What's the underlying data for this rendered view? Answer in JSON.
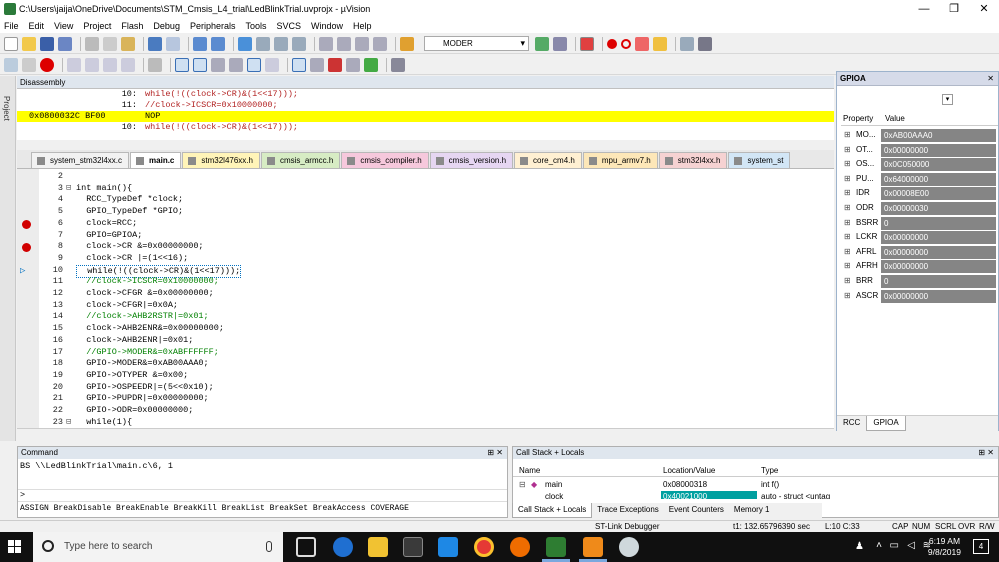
{
  "window": {
    "title": "C:\\Users\\jaija\\OneDrive\\Documents\\STM_Cmsis_L4_trial\\LedBlinkTrial.uvprojx - µVision",
    "min": "—",
    "max": "❐",
    "close": "✕"
  },
  "menu": [
    "File",
    "Edit",
    "View",
    "Project",
    "Flash",
    "Debug",
    "Peripherals",
    "Tools",
    "SVCS",
    "Window",
    "Help"
  ],
  "toolbar": {
    "target": "MODER"
  },
  "left_panel": {
    "label": "Project"
  },
  "disassembly": {
    "title": "Disassembly",
    "lines": [
      {
        "addr": "",
        "num": "10:",
        "code": "while(!((clock->CR)&(1<<17)));",
        "hl": false
      },
      {
        "addr": "",
        "num": "11:",
        "code": "//clock->ICSCR=0x10000000;",
        "hl": false
      },
      {
        "addr": "0x0800032C BF00",
        "num": "",
        "code": "NOP",
        "hl": true
      },
      {
        "addr": "",
        "num": "10:",
        "code": "while(!((clock->CR)&(1<<17)));",
        "hl": false
      }
    ]
  },
  "tabs": [
    {
      "label": "system_stm32l4xx.c",
      "color": "#f2f2f2",
      "active": false
    },
    {
      "label": "main.c",
      "color": "#ffffff",
      "active": true
    },
    {
      "label": "stm32l476xx.h",
      "color": "#fff4b8",
      "active": false
    },
    {
      "label": "cmsis_armcc.h",
      "color": "#d7ecc4",
      "active": false
    },
    {
      "label": "cmsis_compiler.h",
      "color": "#f6c8dc",
      "active": false
    },
    {
      "label": "cmsis_version.h",
      "color": "#e6d6f2",
      "active": false
    },
    {
      "label": "core_cm4.h",
      "color": "#fff0d2",
      "active": false
    },
    {
      "label": "mpu_armv7.h",
      "color": "#fde7b8",
      "active": false
    },
    {
      "label": "stm32l4xx.h",
      "color": "#f6d2d2",
      "active": false
    },
    {
      "label": "system_st",
      "color": "#d2e6f6",
      "active": false
    }
  ],
  "code": [
    {
      "n": "2",
      "t": "",
      "bp": false,
      "cur": false,
      "fold": ""
    },
    {
      "n": "3",
      "t": "int main(){",
      "bp": false,
      "cur": false,
      "fold": "⊟"
    },
    {
      "n": "4",
      "t": "  RCC_TypeDef *clock;",
      "bp": false,
      "cur": false,
      "fold": ""
    },
    {
      "n": "5",
      "t": "  GPIO_TypeDef *GPIO;",
      "bp": false,
      "cur": false,
      "fold": ""
    },
    {
      "n": "6",
      "t": "  clock=RCC;",
      "bp": true,
      "cur": false,
      "fold": ""
    },
    {
      "n": "7",
      "t": "  GPIO=GPIOA;",
      "bp": false,
      "cur": false,
      "fold": ""
    },
    {
      "n": "8",
      "t": "  clock->CR &=0x00000000;",
      "bp": true,
      "cur": false,
      "fold": ""
    },
    {
      "n": "9",
      "t": "  clock->CR |=(1<<16);",
      "bp": false,
      "cur": false,
      "fold": ""
    },
    {
      "n": "10",
      "t": "  while(!((clock->CR)&(1<<17)));",
      "bp": false,
      "cur": true,
      "fold": ""
    },
    {
      "n": "11",
      "t": "  //clock->ICSCR=0x10000000;",
      "bp": false,
      "cur": false,
      "fold": ""
    },
    {
      "n": "12",
      "t": "  clock->CFGR &=0x00000000;",
      "bp": false,
      "cur": false,
      "fold": ""
    },
    {
      "n": "13",
      "t": "  clock->CFGR|=0x0A;",
      "bp": false,
      "cur": false,
      "fold": ""
    },
    {
      "n": "14",
      "t": "  //clock->AHB2RSTR|=0x01;",
      "bp": false,
      "cur": false,
      "fold": ""
    },
    {
      "n": "15",
      "t": "  clock->AHB2ENR&=0x00000000;",
      "bp": false,
      "cur": false,
      "fold": ""
    },
    {
      "n": "16",
      "t": "  clock->AHB2ENR|=0x01;",
      "bp": false,
      "cur": false,
      "fold": ""
    },
    {
      "n": "17",
      "t": "  //GPIO->MODER&=0xABFFFFFF;",
      "bp": false,
      "cur": false,
      "fold": ""
    },
    {
      "n": "18",
      "t": "  GPIO->MODER&=0xAB00AAA0;",
      "bp": false,
      "cur": false,
      "fold": ""
    },
    {
      "n": "19",
      "t": "  GPIO->OTYPER &=0x00;",
      "bp": false,
      "cur": false,
      "fold": ""
    },
    {
      "n": "20",
      "t": "  GPIO->OSPEEDR|=(5<<0x10);",
      "bp": false,
      "cur": false,
      "fold": ""
    },
    {
      "n": "21",
      "t": "  GPIO->PUPDR|=0x00000000;",
      "bp": false,
      "cur": false,
      "fold": ""
    },
    {
      "n": "22",
      "t": "  GPIO->ODR=0x00000000;",
      "bp": false,
      "cur": false,
      "fold": ""
    },
    {
      "n": "23",
      "t": "  while(1){",
      "bp": false,
      "cur": false,
      "fold": "⊟"
    }
  ],
  "gpio": {
    "title": "GPIOA",
    "col_property": "Property",
    "col_value": "Value",
    "rows": [
      {
        "name": "MO...",
        "value": "0xAB00AAA0"
      },
      {
        "name": "OT...",
        "value": "0x00000000"
      },
      {
        "name": "OS...",
        "value": "0x0C050000"
      },
      {
        "name": "PU...",
        "value": "0x64000000"
      },
      {
        "name": "IDR",
        "value": "0x00008E00"
      },
      {
        "name": "ODR",
        "value": "0x00000030"
      },
      {
        "name": "BSRR",
        "value": "0"
      },
      {
        "name": "LCKR",
        "value": "0x00000000"
      },
      {
        "name": "AFRL",
        "value": "0x00000000"
      },
      {
        "name": "AFRH",
        "value": "0x00000000"
      },
      {
        "name": "BRR",
        "value": "0"
      },
      {
        "name": "ASCR",
        "value": "0x00000000"
      }
    ],
    "tabs": [
      "RCC",
      "GPIOA"
    ]
  },
  "command": {
    "title": "Command",
    "output": "BS \\\\LedBlinkTrial\\main.c\\6, 1",
    "prompt": ">",
    "help": "ASSIGN BreakDisable BreakEnable BreakKill BreakList BreakSet BreakAccess COVERAGE"
  },
  "callstack": {
    "title": "Call Stack + Locals",
    "cols": [
      "Name",
      "Location/Value",
      "Type"
    ],
    "rows": [
      {
        "name": "main",
        "loc": "0x08000318",
        "type": "int f()"
      },
      {
        "name": "clock",
        "loc": "0x40021000",
        "type": "auto - struct <untag"
      }
    ],
    "tabs": [
      "Call Stack + Locals",
      "Trace Exceptions",
      "Event Counters",
      "Memory 1"
    ]
  },
  "status": {
    "debugger": "ST-Link Debugger",
    "time": "t1: 132.65796390 sec",
    "pos": "L:10 C:33",
    "caps": "CAP",
    "num": "NUM",
    "scrl": "SCRL",
    "ovr": "OVR",
    "rw": "R/W"
  },
  "taskbar": {
    "search_placeholder": "Type here to search",
    "time": "6:19 AM",
    "date": "9/8/2019",
    "notifications": "4"
  }
}
